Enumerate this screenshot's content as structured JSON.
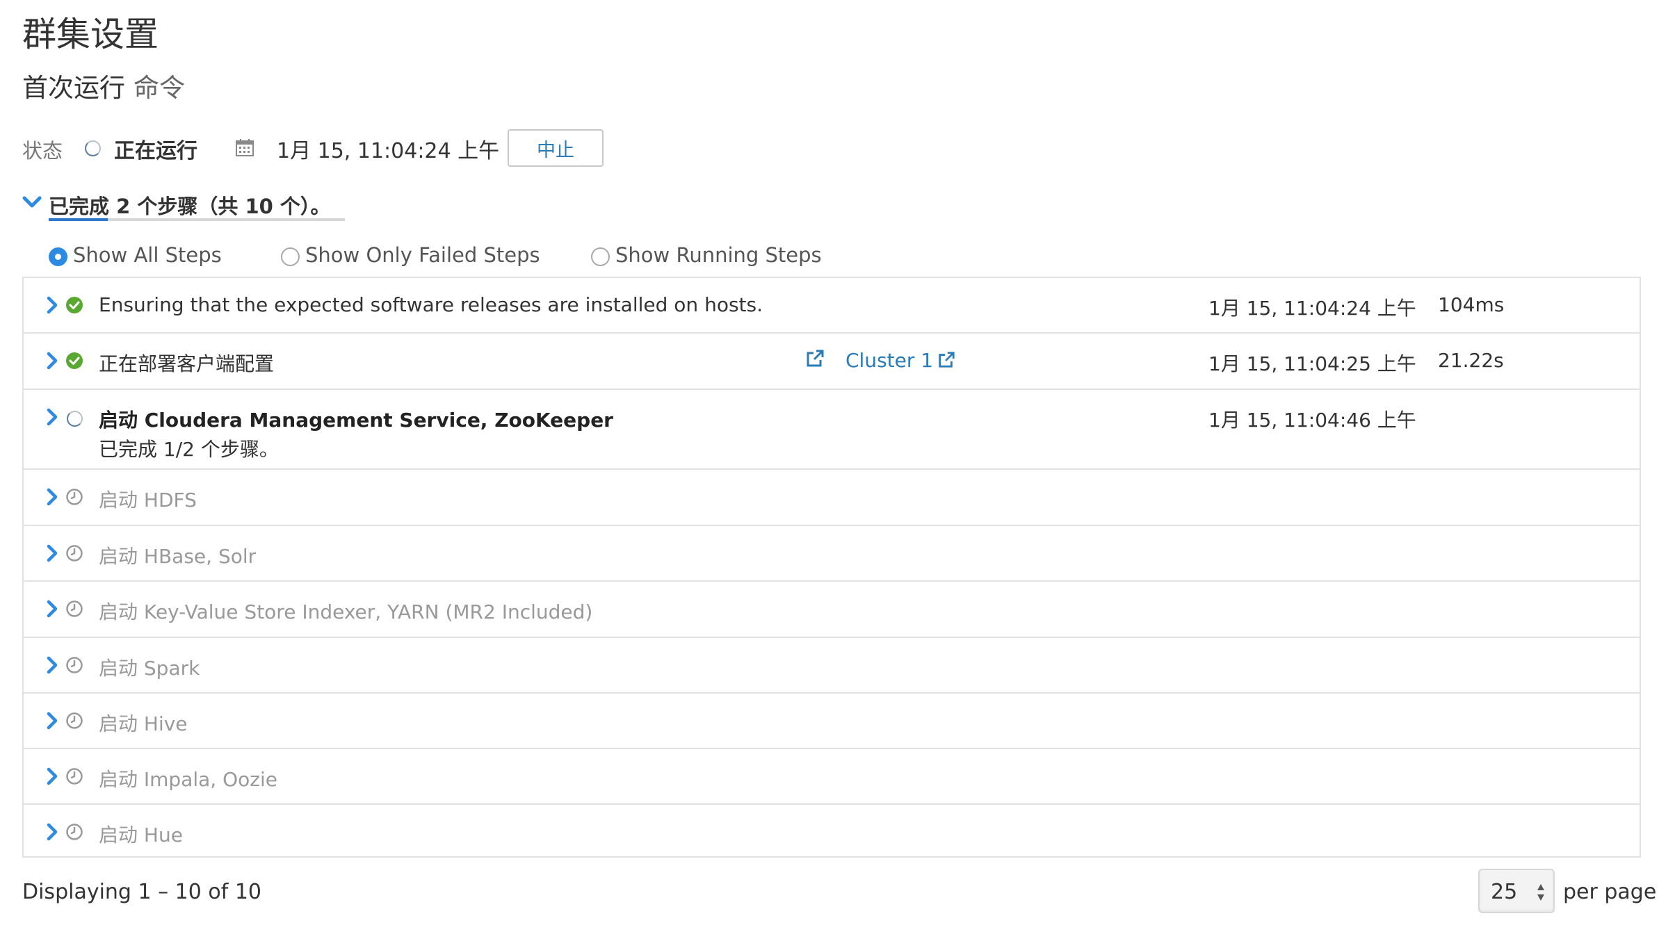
{
  "header": {
    "title": "群集设置",
    "subtitle": "首次运行",
    "subtitle_suffix": "命令"
  },
  "status": {
    "label": "状态",
    "state": "正在运行",
    "started": "1月 15, 11:04:24 上午",
    "abort_label": "中止"
  },
  "summary": {
    "text": "已完成 2 个步骤（共 10 个）。",
    "completed": 2,
    "total": 10
  },
  "filters": {
    "options": [
      "Show All Steps",
      "Show Only Failed Steps",
      "Show Running Steps"
    ],
    "selected": "Show All Steps"
  },
  "steps": [
    {
      "name": "Ensuring that the expected software releases are installed on hosts.",
      "status": "success",
      "time": "1月 15, 11:04:24 上午",
      "duration": "104ms"
    },
    {
      "name": "正在部署客户端配置",
      "status": "success",
      "link": "Cluster 1",
      "time": "1月 15, 11:04:25 上午",
      "duration": "21.22s"
    },
    {
      "name": "启动 Cloudera Management Service, ZooKeeper",
      "status": "running",
      "sub": "已完成 1/2 个步骤。",
      "time": "1月 15, 11:04:46 上午",
      "duration": ""
    },
    {
      "name": "启动 HDFS",
      "status": "pending"
    },
    {
      "name": "启动 HBase, Solr",
      "status": "pending"
    },
    {
      "name": "启动 Key-Value Store Indexer, YARN (MR2 Included)",
      "status": "pending"
    },
    {
      "name": "启动 Spark",
      "status": "pending"
    },
    {
      "name": "启动 Hive",
      "status": "pending"
    },
    {
      "name": "启动 Impala, Oozie",
      "status": "pending"
    },
    {
      "name": "启动 Hue",
      "status": "pending"
    }
  ],
  "footer": {
    "displaying": "Displaying 1 – 10 of 10",
    "per_page_value": "25",
    "per_page_label": "per page"
  },
  "icons": {
    "expand": "chevron-right-icon",
    "collapse": "chevron-down-icon",
    "success": "check-circle-icon",
    "pending": "clock-icon",
    "running": "spinner-icon",
    "calendar": "calendar-icon",
    "external": "external-link-icon"
  },
  "colors": {
    "accent": "#2a7bb8",
    "chevron": "#2d8ae2",
    "success": "#59a832",
    "muted": "#999999",
    "border": "#e2e2e2"
  }
}
